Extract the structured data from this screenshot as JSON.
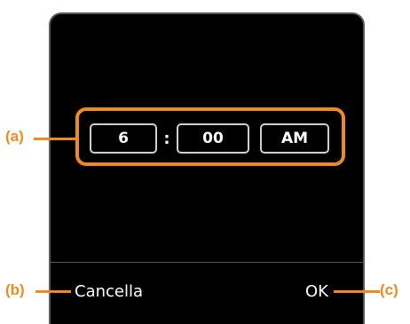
{
  "time_picker": {
    "hour": "6",
    "separator": ":",
    "minute": "00",
    "meridiem": "AM"
  },
  "softkeys": {
    "cancel_label": "Cancella",
    "ok_label": "OK"
  },
  "callouts": {
    "a": "(a)",
    "b": "(b)",
    "c": "(c)"
  },
  "colors": {
    "screen_background": "#000000",
    "highlight": "#f08a1e",
    "field_border": "#cfcfcf",
    "text": "#ffffff"
  }
}
